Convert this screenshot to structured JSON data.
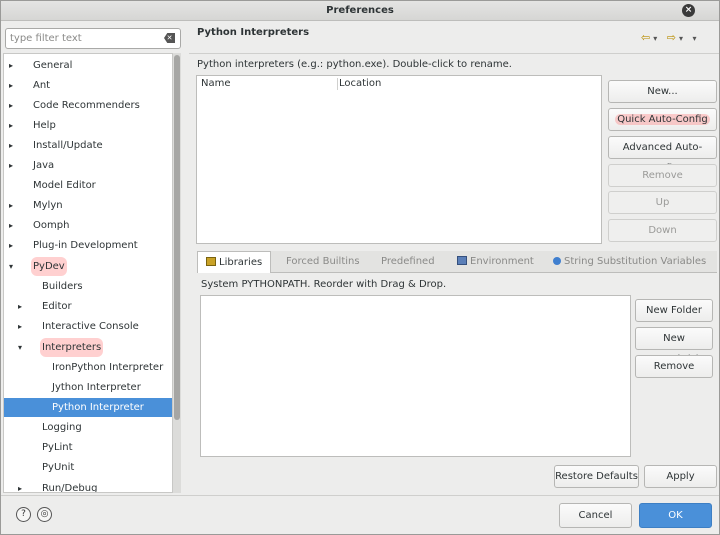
{
  "window": {
    "title": "Preferences",
    "close_glyph": "×"
  },
  "filter": {
    "placeholder": "type filter text",
    "clear_glyph": "✕"
  },
  "tree": {
    "items": [
      {
        "label": "General",
        "arrow": "▸"
      },
      {
        "label": "Ant",
        "arrow": "▸"
      },
      {
        "label": "Code Recommenders",
        "arrow": "▸"
      },
      {
        "label": "Help",
        "arrow": "▸"
      },
      {
        "label": "Install/Update",
        "arrow": "▸"
      },
      {
        "label": "Java",
        "arrow": "▸"
      },
      {
        "label": "Model Editor",
        "arrow": ""
      },
      {
        "label": "Mylyn",
        "arrow": "▸"
      },
      {
        "label": "Oomph",
        "arrow": "▸"
      },
      {
        "label": "Plug-in Development",
        "arrow": "▸"
      },
      {
        "label": "PyDev",
        "arrow": "▾"
      },
      {
        "label": "Builders",
        "arrow": ""
      },
      {
        "label": "Editor",
        "arrow": "▸"
      },
      {
        "label": "Interactive Console",
        "arrow": "▸"
      },
      {
        "label": "Interpreters",
        "arrow": "▾"
      },
      {
        "label": "IronPython Interpreter",
        "arrow": ""
      },
      {
        "label": "Jython Interpreter",
        "arrow": ""
      },
      {
        "label": "Python Interpreter",
        "arrow": ""
      },
      {
        "label": "Logging",
        "arrow": ""
      },
      {
        "label": "PyLint",
        "arrow": ""
      },
      {
        "label": "PyUnit",
        "arrow": ""
      },
      {
        "label": "Run/Debug",
        "arrow": "▸"
      }
    ],
    "selected": "Python Interpreter"
  },
  "page": {
    "title": "Python Interpreters",
    "description": "Python interpreters (e.g.: python.exe).   Double-click to rename.",
    "nav": {
      "back": "⇦",
      "forward": "⇨",
      "dropdown": "▾",
      "menu": "▾"
    }
  },
  "interpreter_table": {
    "columns": [
      "Name",
      "Location"
    ],
    "rows": []
  },
  "interpreter_buttons": {
    "new": "New...",
    "quick": "Quick Auto-Config",
    "advanced": "Advanced Auto-Config",
    "remove": "Remove",
    "up": "Up",
    "down": "Down"
  },
  "tabs": [
    {
      "label": "Libraries",
      "active": true
    },
    {
      "label": "Forced Builtins",
      "active": false
    },
    {
      "label": "Predefined",
      "active": false
    },
    {
      "label": "Environment",
      "active": false
    },
    {
      "label": "String Substitution Variables",
      "active": false
    }
  ],
  "libraries": {
    "label": "System PYTHONPATH.   Reorder with Drag & Drop.",
    "items": [],
    "buttons": {
      "new_folder": "New Folder",
      "new_egg": "New Egg/Zip(s)",
      "remove": "Remove"
    }
  },
  "page_buttons": {
    "restore": "Restore Defaults",
    "apply": "Apply"
  },
  "footer": {
    "help_glyph": "?",
    "import_glyph": "◎",
    "cancel": "Cancel",
    "ok": "OK"
  },
  "colors": {
    "selection": "#4a90d9",
    "highlight": "#ff7878"
  }
}
